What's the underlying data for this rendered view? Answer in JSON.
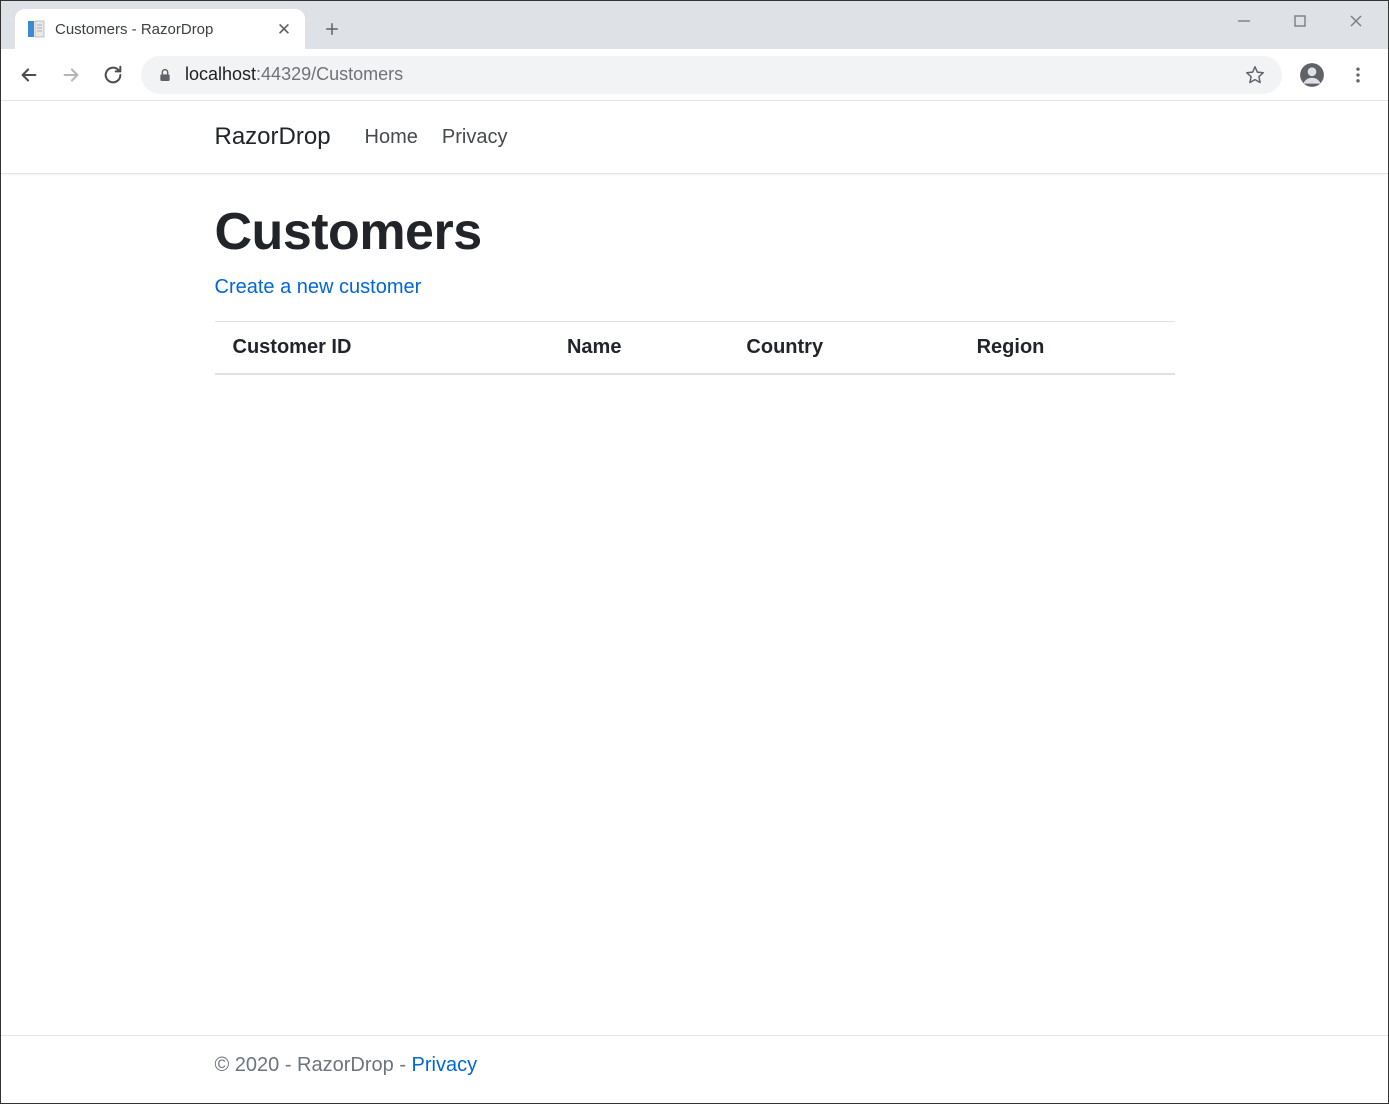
{
  "browser": {
    "tab_title": "Customers - RazorDrop",
    "url_host": "localhost",
    "url_port_path": ":44329/Customers"
  },
  "navbar": {
    "brand": "RazorDrop",
    "links": [
      "Home",
      "Privacy"
    ]
  },
  "page": {
    "heading": "Customers",
    "create_link_label": "Create a new customer",
    "table": {
      "columns": [
        "Customer ID",
        "Name",
        "Country",
        "Region"
      ],
      "rows": []
    }
  },
  "footer": {
    "text": "© 2020 - RazorDrop - ",
    "privacy_label": "Privacy"
  }
}
